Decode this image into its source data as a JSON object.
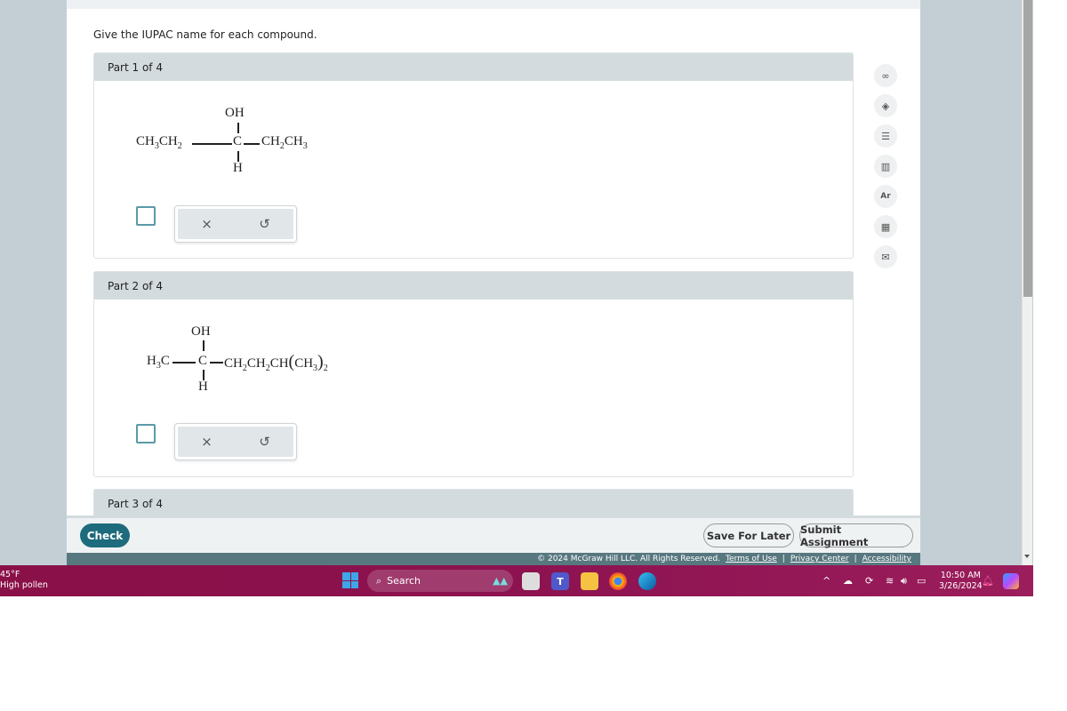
{
  "instruction": "Give the IUPAC name for each compound.",
  "parts": [
    {
      "label": "Part 1 of 4",
      "molecule": {
        "top": "OH",
        "bottom": "H",
        "center": "C"
      }
    },
    {
      "label": "Part 2 of 4",
      "molecule": {
        "top": "OH",
        "bottom": "H",
        "center": "C"
      }
    },
    {
      "label": "Part 3 of 4"
    }
  ],
  "tools": {
    "clear_icon": "×",
    "undo_icon": "↺"
  },
  "side_icons": [
    "glasses-icon",
    "directions-icon",
    "notes-icon",
    "chart-icon",
    "periodic-table-icon",
    "calculator-icon",
    "mail-icon"
  ],
  "buttons": {
    "check": "Check",
    "save": "Save For Later",
    "submit": "Submit Assignment"
  },
  "footer": {
    "copyright": "© 2024 McGraw Hill LLC. All Rights Reserved.",
    "terms": "Terms of Use",
    "privacy": "Privacy Center",
    "accessibility": "Accessibility"
  },
  "taskbar": {
    "weather_temp": "45°F",
    "weather_desc": "High pollen",
    "search_label": "Search",
    "time": "10:50 AM",
    "date": "3/26/2024"
  }
}
